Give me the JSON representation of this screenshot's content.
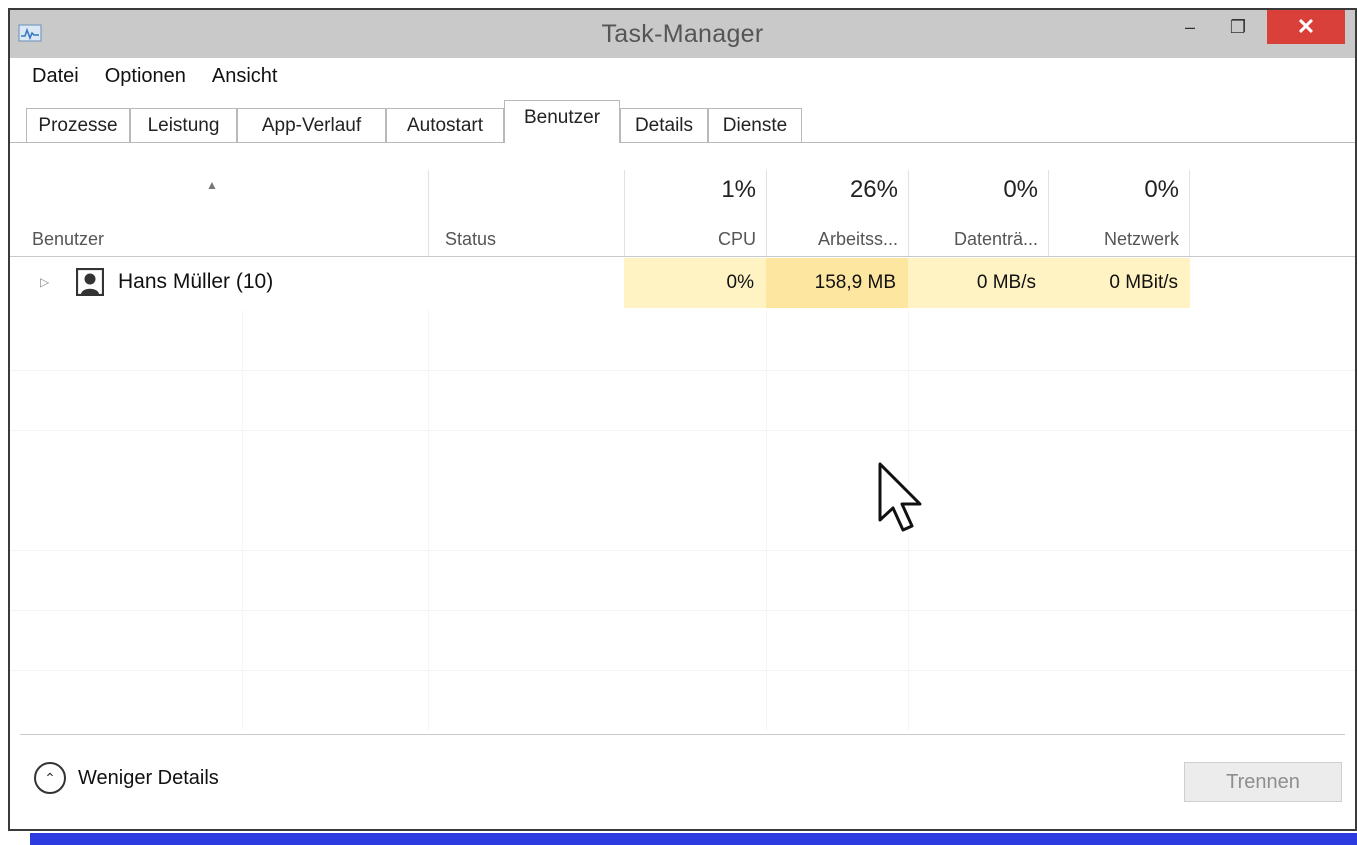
{
  "window": {
    "title": "Task-Manager",
    "minimize": "–",
    "maximize": "❐",
    "close": "✕"
  },
  "menu": {
    "items": [
      "Datei",
      "Optionen",
      "Ansicht"
    ]
  },
  "tabs": [
    "Prozesse",
    "Leistung",
    "App-Verlauf",
    "Autostart",
    "Benutzer",
    "Details",
    "Dienste"
  ],
  "active_tab": "Benutzer",
  "columns": {
    "user": {
      "label": "Benutzer"
    },
    "status": {
      "label": "Status"
    },
    "cpu": {
      "percent": "1%",
      "label": "CPU"
    },
    "memory": {
      "percent": "26%",
      "label": "Arbeitss..."
    },
    "disk": {
      "percent": "0%",
      "label": "Datenträ..."
    },
    "network": {
      "percent": "0%",
      "label": "Netzwerk"
    }
  },
  "rows": [
    {
      "user": "Hans Müller (10)",
      "status": "",
      "cpu": "0%",
      "memory": "158,9 MB",
      "disk": "0 MB/s",
      "network": "0 MBit/s"
    }
  ],
  "footer": {
    "fewer_details": "Weniger Details",
    "end_button": "Trennen"
  },
  "colors": {
    "heat_light": "#fff3c4",
    "heat_medium": "#fde6a0",
    "close_red": "#d9403a",
    "strip_blue": "#2c3be0"
  }
}
